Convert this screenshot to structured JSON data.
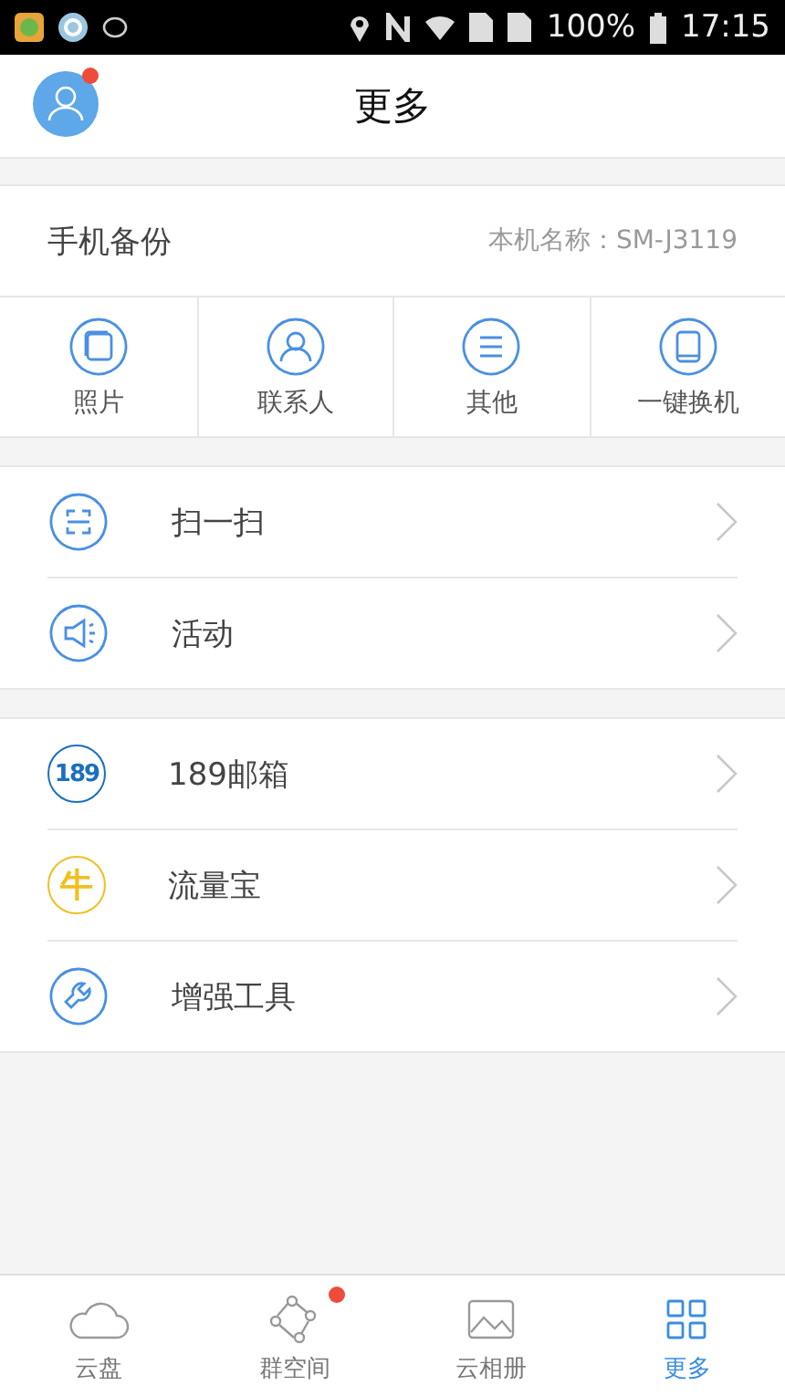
{
  "status_bar": {
    "battery": "100%",
    "time": "17:15"
  },
  "header": {
    "title": "更多",
    "avatar_notification": true
  },
  "backup": {
    "title": "手机备份",
    "device_name": "本机名称：SM-J3119",
    "actions": [
      {
        "kind": "photos",
        "label": "照片"
      },
      {
        "kind": "contacts",
        "label": "联系人"
      },
      {
        "kind": "other",
        "label": "其他"
      },
      {
        "kind": "switch",
        "label": "一键换机"
      }
    ]
  },
  "menu_groups": [
    [
      {
        "kind": "scan",
        "label": "扫一扫"
      },
      {
        "kind": "campaign",
        "label": "活动"
      }
    ],
    [
      {
        "kind": "mail",
        "icon_text": "189",
        "label": "189邮箱"
      },
      {
        "kind": "traffic",
        "icon_text": "牛",
        "label": "流量宝"
      },
      {
        "kind": "tools",
        "label": "增强工具"
      }
    ]
  ],
  "tabs": [
    {
      "kind": "cloud",
      "label": "云盘",
      "selected": false,
      "notification": false
    },
    {
      "kind": "group",
      "label": "群空间",
      "selected": false,
      "notification": true
    },
    {
      "kind": "album",
      "label": "云相册",
      "selected": false,
      "notification": false
    },
    {
      "kind": "more",
      "label": "更多",
      "selected": true,
      "notification": false
    }
  ]
}
